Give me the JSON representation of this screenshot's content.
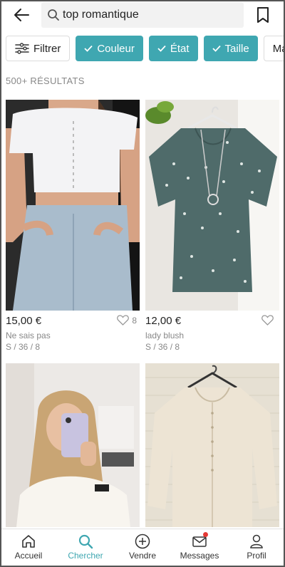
{
  "search": {
    "query": "top romantique"
  },
  "filters": [
    {
      "label": "Filtrer",
      "active": false
    },
    {
      "label": "Couleur",
      "active": true
    },
    {
      "label": "État",
      "active": true
    },
    {
      "label": "Taille",
      "active": true
    },
    {
      "label": "Marqu",
      "active": false
    }
  ],
  "results_count": "500+ RÉSULTATS",
  "items": [
    {
      "price": "15,00 €",
      "brand": "Ne sais pas",
      "size": "S / 36 / 8",
      "likes": "8"
    },
    {
      "price": "12,00 €",
      "brand": "lady blush",
      "size": "S / 36 / 8",
      "likes": ""
    },
    {
      "price": "",
      "brand": "",
      "size": "",
      "likes": ""
    },
    {
      "price": "",
      "brand": "",
      "size": "",
      "likes": ""
    }
  ],
  "nav": [
    {
      "label": "Accueil",
      "icon": "home-icon"
    },
    {
      "label": "Chercher",
      "icon": "search-icon",
      "active": true
    },
    {
      "label": "Vendre",
      "icon": "plus-circle-icon"
    },
    {
      "label": "Messages",
      "icon": "mail-icon",
      "badge": true
    },
    {
      "label": "Profil",
      "icon": "user-icon"
    }
  ],
  "colors": {
    "accent": "#3fa7b1",
    "badge": "#e53935"
  }
}
